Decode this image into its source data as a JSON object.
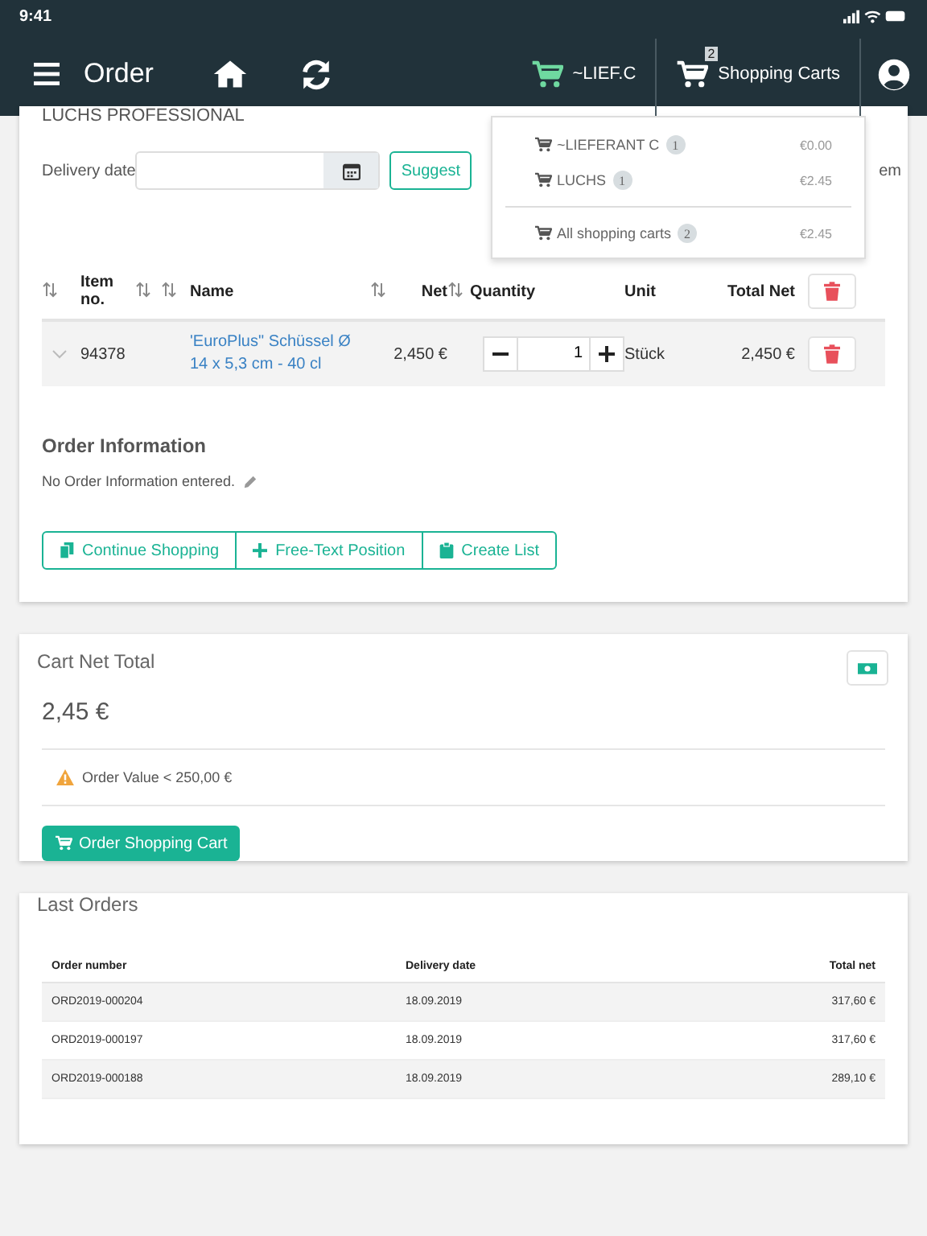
{
  "status_bar": {
    "time": "9:41"
  },
  "nav": {
    "title": "Order",
    "cart_label": "~LIEF.C",
    "carts_label": "Shopping Carts",
    "carts_badge": "2"
  },
  "dropdown": {
    "items": [
      {
        "name": "~LIEFERANT C",
        "count": "1",
        "amount": "€0.00"
      },
      {
        "name": "LUCHS",
        "count": "1",
        "amount": "€2.45"
      }
    ],
    "total": {
      "name": "All shopping carts",
      "count": "2",
      "amount": "€2.45"
    }
  },
  "cart_card": {
    "title": "LUCHS PROFESSIONAL",
    "delivery_label": "Delivery date",
    "suggest_button": "Suggest",
    "cut_label": "em",
    "columns": [
      "Item no.",
      "Name",
      "Net",
      "Quantity",
      "Unit",
      "Total Net"
    ],
    "rows": [
      {
        "item_no": "94378",
        "name": "'EuroPlus\" Schüssel Ø 14 x 5,3 cm - 40 cl",
        "net": "2,450 €",
        "quantity": "1",
        "unit": "Stück",
        "total": "2,450 €"
      }
    ],
    "order_info": {
      "title": "Order Information",
      "text": "No Order Information entered."
    },
    "actions": [
      {
        "kind": "copy",
        "label": "Continue Shopping"
      },
      {
        "kind": "plus",
        "label": "Free-Text Position"
      },
      {
        "kind": "clipboard",
        "label": "Create List"
      }
    ]
  },
  "total_card": {
    "title": "Cart Net Total",
    "amount": "2,45 €",
    "warning": "Order Value < 250,00 €",
    "order_button": "Order Shopping Cart"
  },
  "last_orders": {
    "title": "Last Orders",
    "columns": [
      "Order number",
      "Delivery date",
      "Total net"
    ],
    "rows": [
      {
        "number": "ORD2019-000204",
        "date": "18.09.2019",
        "total": "317,60 €"
      },
      {
        "number": "ORD2019-000197",
        "date": "18.09.2019",
        "total": "317,60 €"
      },
      {
        "number": "ORD2019-000188",
        "date": "18.09.2019",
        "total": "289,10 €"
      }
    ]
  }
}
